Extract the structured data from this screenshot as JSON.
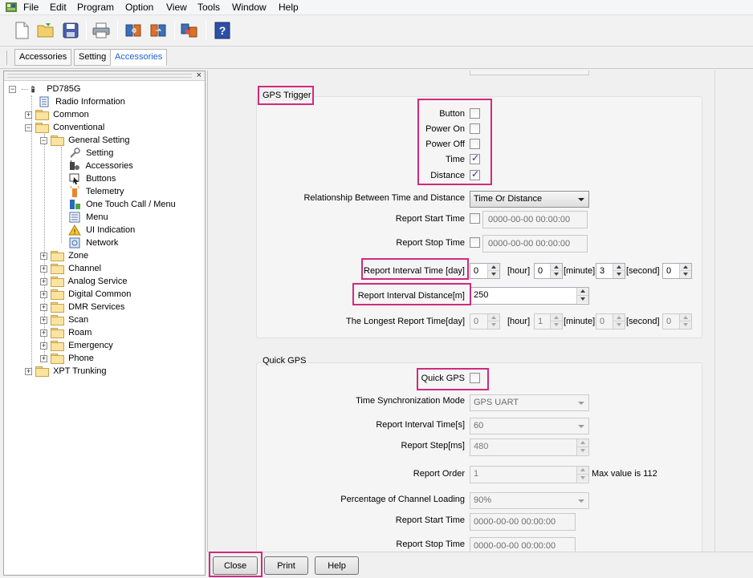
{
  "menu": [
    "File",
    "Edit",
    "Program",
    "Option",
    "View",
    "Tools",
    "Window",
    "Help"
  ],
  "tabs": [
    "Accessories",
    "Setting",
    "Accessories"
  ],
  "tree": {
    "close": "×",
    "root": "PD785G",
    "items": {
      "radio_information": "Radio Information",
      "common": "Common",
      "conventional": "Conventional",
      "general_setting": "General Setting",
      "setting": "Setting",
      "accessories": "Accessories",
      "buttons": "Buttons",
      "telemetry": "Telemetry",
      "one_touch": "One Touch Call / Menu",
      "menu": "Menu",
      "ui_indication": "UI Indication",
      "network": "Network",
      "zone": "Zone",
      "channel": "Channel",
      "analog_service": "Analog Service",
      "digital_common": "Digital Common",
      "dmr_services": "DMR Services",
      "scan": "Scan",
      "roam": "Roam",
      "emergency": "Emergency",
      "phone": "Phone",
      "xpt_trunking": "XPT Trunking"
    }
  },
  "gps_trigger": {
    "title": "GPS Trigger",
    "button_label": "Button",
    "button_checked": false,
    "power_on_label": "Power On",
    "power_on_checked": false,
    "power_off_label": "Power Off",
    "power_off_checked": false,
    "time_label": "Time",
    "time_checked": true,
    "distance_label": "Distance",
    "distance_checked": true,
    "relationship_label": "Relationship Between Time and Distance",
    "relationship_value": "Time Or Distance",
    "report_start_label": "Report Start Time",
    "report_start_value": "0000-00-00  00:00:00",
    "report_stop_label": "Report Stop Time",
    "report_stop_value": "0000-00-00  00:00:00",
    "interval_time_label": "Report Interval Time [day]",
    "interval_day": "0",
    "hour_label": "[hour]",
    "interval_hour": "0",
    "minute_label": "[minute]",
    "interval_minute": "3",
    "second_label": "[second]",
    "interval_second": "0",
    "interval_distance_label": "Report Interval Distance[m]",
    "interval_distance_value": "250",
    "longest_label": "The Longest Report Time[day]",
    "longest_day": "0",
    "longest_hour": "1",
    "longest_minute": "0",
    "longest_second": "0"
  },
  "quick_gps": {
    "title": "Quick GPS",
    "quick_gps_label": "Quick GPS",
    "quick_gps_checked": false,
    "time_sync_label": "Time Synchronization Mode",
    "time_sync_value": "GPS UART",
    "interval_label": "Report Interval Time[s]",
    "interval_value": "60",
    "step_label": "Report Step[ms]",
    "step_value": "480",
    "order_label": "Report Order",
    "order_value": "1",
    "order_max": "Max value is 112",
    "percentage_label": "Percentage of Channel Loading",
    "percentage_value": "90%",
    "start_label": "Report Start Time",
    "start_value": "0000-00-00  00:00:00",
    "stop_label": "Report Stop Time",
    "stop_value": "0000-00-00  00:00:00"
  },
  "buttons": {
    "close": "Close",
    "print": "Print",
    "help": "Help"
  },
  "colors": {
    "highlight": "#d12a7d",
    "active_tab": "#1f5fd1"
  }
}
